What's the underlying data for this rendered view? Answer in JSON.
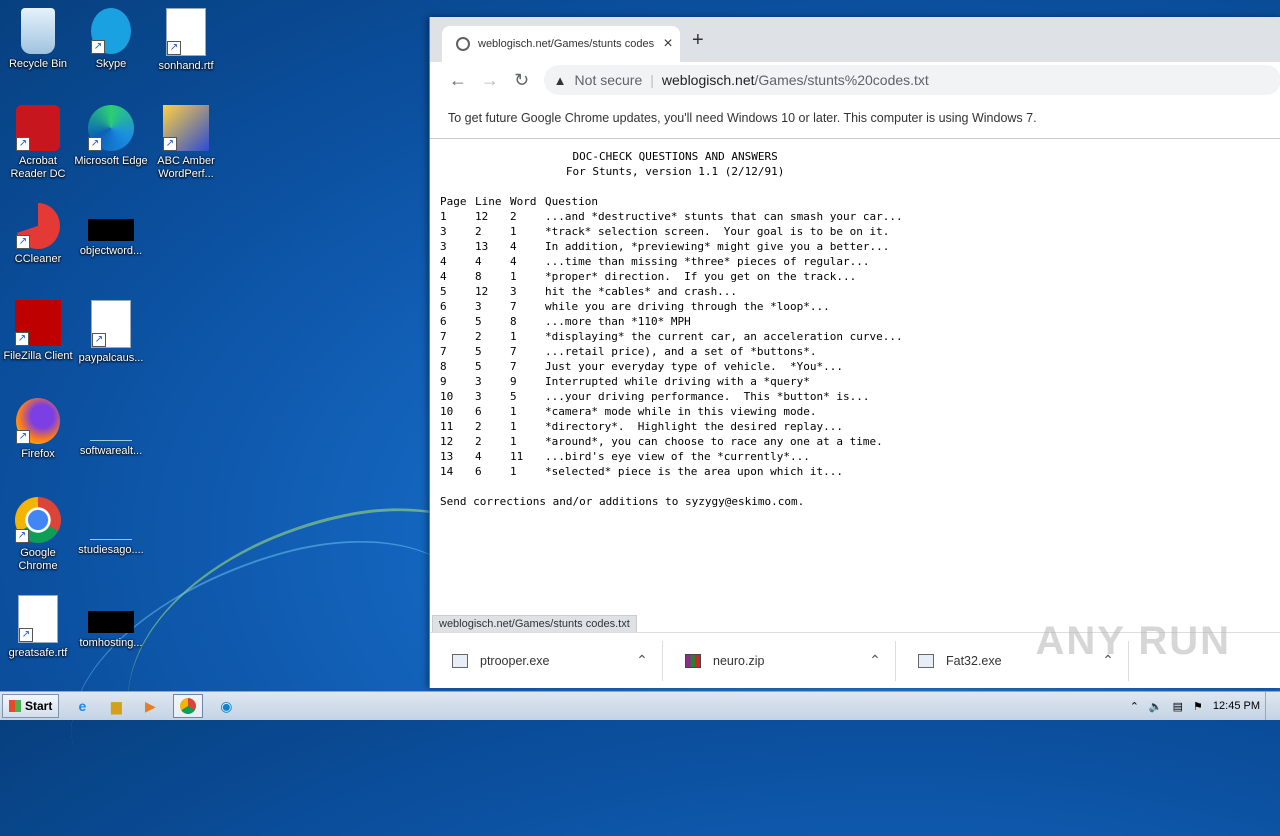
{
  "desktop": {
    "icons": [
      {
        "label": "Recycle Bin",
        "icon": "recycle-bin-icon"
      },
      {
        "label": "Skype",
        "icon": "skype-icon"
      },
      {
        "label": "sonhand.rtf",
        "icon": "word-document-icon"
      },
      {
        "label": "Acrobat Reader DC",
        "icon": "acrobat-icon"
      },
      {
        "label": "Microsoft Edge",
        "icon": "edge-icon"
      },
      {
        "label": "ABC Amber WordPerf...",
        "icon": "abc-amber-icon"
      },
      {
        "label": "CCleaner",
        "icon": "ccleaner-icon"
      },
      {
        "label": "objectword...",
        "icon": "black-file-icon"
      },
      {
        "label": "FileZilla Client",
        "icon": "filezilla-icon"
      },
      {
        "label": "paypalcaus...",
        "icon": "word-document-icon"
      },
      {
        "label": "Firefox",
        "icon": "firefox-icon"
      },
      {
        "label": "softwarealt...",
        "icon": "blank-file-icon"
      },
      {
        "label": "Google Chrome",
        "icon": "chrome-icon"
      },
      {
        "label": "studiesago....",
        "icon": "blank-file-icon"
      },
      {
        "label": "greatsafe.rtf",
        "icon": "word-document-icon"
      },
      {
        "label": "tomhosting...",
        "icon": "black-file-icon"
      }
    ]
  },
  "browser": {
    "tab_title": "weblogisch.net/Games/stunts codes",
    "new_tab": "+",
    "security_label": "Not secure",
    "url_host": "weblogisch.net",
    "url_path": "/Games/stunts%20codes.txt",
    "infobar": "To get future Google Chrome updates, you'll need Windows 10 or later. This computer is using Windows 7.",
    "status_url": "weblogisch.net/Games/stunts codes.txt",
    "watermark": "ANY RUN"
  },
  "document": {
    "title1": "                    DOC-CHECK QUESTIONS AND ANSWERS",
    "title2": "                   For Stunts, version 1.1 (2/12/91)",
    "columns": [
      "Page",
      "Line",
      "Word",
      "Question"
    ],
    "rows": [
      [
        "1",
        "12",
        "2",
        "...and *destructive* stunts that can smash your car..."
      ],
      [
        "3",
        "2",
        "1",
        "*track* selection screen.  Your goal is to be on it."
      ],
      [
        "3",
        "13",
        "4",
        "In addition, *previewing* might give you a better..."
      ],
      [
        "4",
        "4",
        "4",
        "...time than missing *three* pieces of regular..."
      ],
      [
        "4",
        "8",
        "1",
        "*proper* direction.  If you get on the track..."
      ],
      [
        "5",
        "12",
        "3",
        "hit the *cables* and crash..."
      ],
      [
        "6",
        "3",
        "7",
        "while you are driving through the *loop*..."
      ],
      [
        "6",
        "5",
        "8",
        "...more than *110* MPH"
      ],
      [
        "7",
        "2",
        "1",
        "*displaying* the current car, an acceleration curve..."
      ],
      [
        "7",
        "5",
        "7",
        "...retail price), and a set of *buttons*."
      ],
      [
        "8",
        "5",
        "7",
        "Just your everyday type of vehicle.  *You*..."
      ],
      [
        "9",
        "3",
        "9",
        "Interrupted while driving with a *query*"
      ],
      [
        "10",
        "3",
        "5",
        "...your driving performance.  This *button* is..."
      ],
      [
        "10",
        "6",
        "1",
        "*camera* mode while in this viewing mode."
      ],
      [
        "11",
        "2",
        "1",
        "*directory*.  Highlight the desired replay..."
      ],
      [
        "12",
        "2",
        "1",
        "*around*, you can choose to race any one at a time."
      ],
      [
        "13",
        "4",
        "11",
        "...bird's eye view of the *currently*..."
      ],
      [
        "14",
        "6",
        "1",
        "*selected* piece is the area upon which it..."
      ]
    ],
    "footer": "Send corrections and/or additions to syzygy@eskimo.com."
  },
  "downloads": [
    {
      "name": "ptrooper.exe",
      "icon": "exe-file-icon"
    },
    {
      "name": "neuro.zip",
      "icon": "zip-file-icon"
    },
    {
      "name": "Fat32.exe",
      "icon": "exe-file-icon"
    }
  ],
  "taskbar": {
    "start_label": "Start",
    "clock": "12:45 PM"
  }
}
